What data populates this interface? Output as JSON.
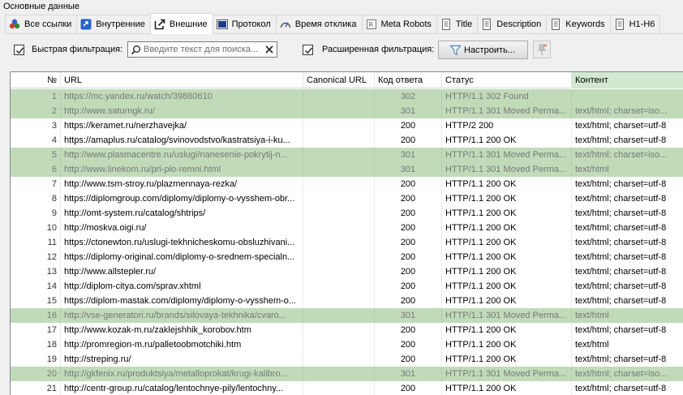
{
  "section": {
    "title": "Основные данные"
  },
  "tabs": [
    {
      "label": "Все ссылки",
      "icon": "all-links-icon",
      "active": false
    },
    {
      "label": "Внутренние",
      "icon": "internal-links-icon",
      "active": false
    },
    {
      "label": "Внешние",
      "icon": "external-links-icon",
      "active": true
    },
    {
      "label": "Протокол",
      "icon": "protocol-icon",
      "active": false
    },
    {
      "label": "Время отклика",
      "icon": "speedometer-icon",
      "active": false
    },
    {
      "label": "Meta Robots",
      "icon": "meta-robots-icon",
      "active": false
    },
    {
      "label": "Title",
      "icon": "document-icon",
      "active": false
    },
    {
      "label": "Description",
      "icon": "document-icon",
      "active": false
    },
    {
      "label": "Keywords",
      "icon": "document-icon",
      "active": false
    },
    {
      "label": "H1-H6",
      "icon": "document-icon",
      "active": false
    }
  ],
  "filters": {
    "quick_label": "Быстрая фильтрация:",
    "quick_checked": true,
    "search_placeholder": "Введите текст для поиска...",
    "advanced_label": "Расширенная фильтрация:",
    "advanced_checked": true,
    "setup_button": "Настроить..."
  },
  "colors": {
    "redirect_row": "#c1dbb9",
    "last_header": "#d2e8d0",
    "border": "#828790"
  },
  "table": {
    "columns": [
      "№",
      "URL",
      "Canonical URL",
      "Код ответа",
      "Статус",
      "Контент"
    ],
    "rows": [
      {
        "n": "1",
        "url": "https://mc.yandex.ru/watch/39880610",
        "canonical": "",
        "code": "302",
        "status": "HTTP/1.1 302 Found",
        "content": "",
        "redirect": true
      },
      {
        "n": "2",
        "url": "http://www.saturngk.ru/",
        "canonical": "",
        "code": "301",
        "status": "HTTP/1.1 301 Moved Perma...",
        "content": "text/html; charset=iso...",
        "redirect": true
      },
      {
        "n": "3",
        "url": "https://keramet.ru/nerzhavejka/",
        "canonical": "",
        "code": "200",
        "status": "HTTP/2 200",
        "content": "text/html; charset=utf-8",
        "redirect": false
      },
      {
        "n": "4",
        "url": "https://amaplus.ru/catalog/svinovodstvo/kastratsiya-i-ku...",
        "canonical": "",
        "code": "200",
        "status": "HTTP/1.1 200 OK",
        "content": "text/html; charset=utf-8",
        "redirect": false
      },
      {
        "n": "5",
        "url": "http://www.plasmacentre.ru/uslugi/nanesenie-pokrytij-n...",
        "canonical": "",
        "code": "301",
        "status": "HTTP/1.1 301 Moved Perma...",
        "content": "text/html; charset=iso...",
        "redirect": true
      },
      {
        "n": "6",
        "url": "http://www.linekom.ru/pri-plo-remni.html",
        "canonical": "",
        "code": "301",
        "status": "HTTP/1.1 301 Moved Perma...",
        "content": "text/html",
        "redirect": true
      },
      {
        "n": "7",
        "url": "http://www.tsm-stroy.ru/plazmennaya-rezka/",
        "canonical": "",
        "code": "200",
        "status": "HTTP/1.1 200 OK",
        "content": "text/html; charset=utf-8",
        "redirect": false
      },
      {
        "n": "8",
        "url": "https://diplomgroup.com/diplomy/diplomy-o-vysshem-obr...",
        "canonical": "",
        "code": "200",
        "status": "HTTP/1.1 200 OK",
        "content": "text/html; charset=utf-8",
        "redirect": false
      },
      {
        "n": "9",
        "url": "http://omt-system.ru/catalog/shtrips/",
        "canonical": "",
        "code": "200",
        "status": "HTTP/1.1 200 OK",
        "content": "text/html; charset=utf-8",
        "redirect": false
      },
      {
        "n": "10",
        "url": "http://moskva.oigi.ru/",
        "canonical": "",
        "code": "200",
        "status": "HTTP/1.1 200 OK",
        "content": "text/html; charset=utf-8",
        "redirect": false
      },
      {
        "n": "11",
        "url": "https://ctonewton.ru/uslugi-tekhnicheskomu-obsluzhivani...",
        "canonical": "",
        "code": "200",
        "status": "HTTP/1.1 200 OK",
        "content": "text/html; charset=utf-8",
        "redirect": false
      },
      {
        "n": "12",
        "url": "https://diplomy-original.com/diplomy-o-srednem-specialn...",
        "canonical": "",
        "code": "200",
        "status": "HTTP/1.1 200 OK",
        "content": "text/html; charset=utf-8",
        "redirect": false
      },
      {
        "n": "13",
        "url": "http://www.allstepler.ru/",
        "canonical": "",
        "code": "200",
        "status": "HTTP/1.1 200 OK",
        "content": "text/html; charset=utf-8",
        "redirect": false
      },
      {
        "n": "14",
        "url": "http://diplom-citya.com/sprav.xhtml",
        "canonical": "",
        "code": "200",
        "status": "HTTP/1.1 200 OK",
        "content": "text/html; charset=utf-8",
        "redirect": false
      },
      {
        "n": "15",
        "url": "https://diplom-mastak.com/diplomy/diplomy-o-vysshem-o...",
        "canonical": "",
        "code": "200",
        "status": "HTTP/1.1 200 OK",
        "content": "text/html; charset=utf-8",
        "redirect": false
      },
      {
        "n": "16",
        "url": "http://vse-generatori.ru/brands/silovaya-tekhnika/cvaro...",
        "canonical": "",
        "code": "301",
        "status": "HTTP/1.1 301 Moved Perma...",
        "content": "text/html",
        "redirect": true
      },
      {
        "n": "17",
        "url": "http://www.kozak-m.ru/zaklejshhik_korobov.htm",
        "canonical": "",
        "code": "200",
        "status": "HTTP/1.1 200 OK",
        "content": "text/html; charset=utf-8",
        "redirect": false
      },
      {
        "n": "18",
        "url": "http://promregion-m.ru/palletoobmotchiki.htm",
        "canonical": "",
        "code": "200",
        "status": "HTTP/1.1 200 OK",
        "content": "text/html",
        "redirect": false
      },
      {
        "n": "19",
        "url": "http://streping.ru/",
        "canonical": "",
        "code": "200",
        "status": "HTTP/1.1 200 OK",
        "content": "text/html; charset=utf-8",
        "redirect": false
      },
      {
        "n": "20",
        "url": "http://gkfenix.ru/produktsiya/metalloprokat/krugi-kalibro...",
        "canonical": "",
        "code": "301",
        "status": "HTTP/1.1 301 Moved Perma...",
        "content": "text/html; charset=iso...",
        "redirect": true
      },
      {
        "n": "21",
        "url": "http://centr-group.ru/catalog/lentochnye-pily/lentochny...",
        "canonical": "",
        "code": "200",
        "status": "HTTP/1.1 200 OK",
        "content": "text/html; charset=utf-8",
        "redirect": false
      }
    ]
  }
}
